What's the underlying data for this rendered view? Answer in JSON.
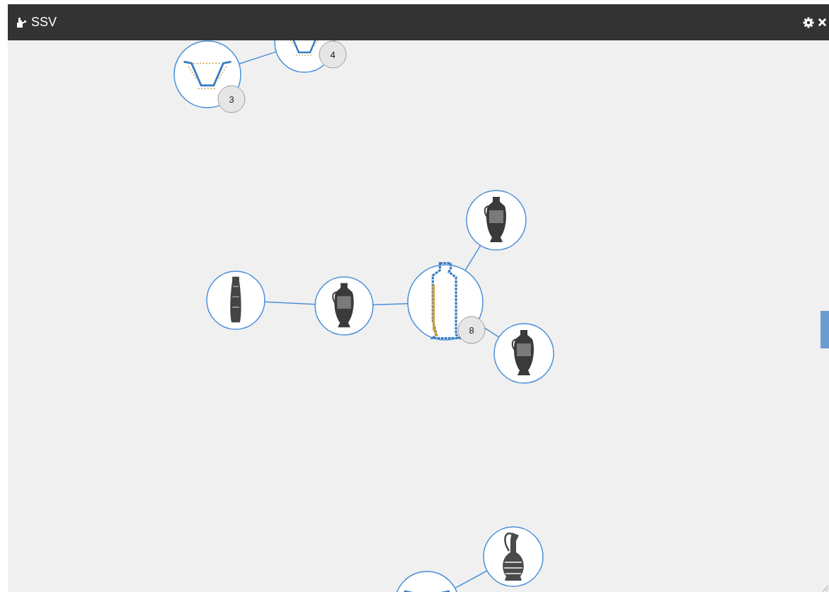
{
  "window": {
    "title": "SSV"
  },
  "graph": {
    "nodes": [
      {
        "kind": "cup",
        "badge": "3"
      },
      {
        "kind": "cup",
        "badge": "4"
      },
      {
        "kind": "amphora"
      },
      {
        "kind": "alabastron"
      },
      {
        "kind": "amphora"
      },
      {
        "kind": "lekythos-outline",
        "badge": "8"
      },
      {
        "kind": "amphora"
      },
      {
        "kind": "jug"
      },
      {
        "kind": "cup"
      }
    ]
  }
}
